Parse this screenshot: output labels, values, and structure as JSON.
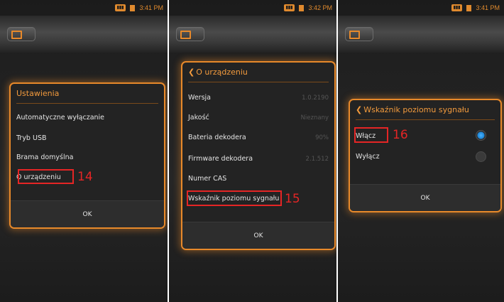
{
  "screens": [
    {
      "status_time": "3:41 PM",
      "dialog": {
        "title": "Ustawienia",
        "items": [
          "Automatyczne wyłączanie",
          "Tryb USB",
          "Brama domyślna",
          "O urządzeniu"
        ],
        "ok": "OK"
      },
      "callout": "14"
    },
    {
      "status_time": "3:42 PM",
      "dialog": {
        "title": "O urządzeniu",
        "rows": [
          {
            "label": "Wersja",
            "value": "1.0.2190"
          },
          {
            "label": "Jakość",
            "value": "Nieznany"
          },
          {
            "label": "Bateria dekodera",
            "value": "90%"
          },
          {
            "label": "Firmware dekodera",
            "value": "2.1.512"
          },
          {
            "label": "Numer CAS",
            "value": ""
          },
          {
            "label": "Wskaźnik poziomu sygnału",
            "value": ""
          }
        ],
        "ok": "OK"
      },
      "callout": "15"
    },
    {
      "status_time": "3:41 PM",
      "dialog": {
        "title": "Wskaźnik poziomu sygnału",
        "options": [
          {
            "label": "Włącz",
            "selected": true
          },
          {
            "label": "Wyłącz",
            "selected": false
          }
        ],
        "ok": "OK"
      },
      "callout": "16"
    }
  ],
  "icons": {
    "status_badge": "signal-badge-icon",
    "status_square": "sd-card-icon",
    "device": "set-top-box-icon",
    "back": "chevron-left-icon"
  },
  "colors": {
    "accent_orange": "#e8892a",
    "callout_red": "#e52525",
    "radio_blue": "#1f86d6",
    "dialog_bg": "#232323"
  }
}
